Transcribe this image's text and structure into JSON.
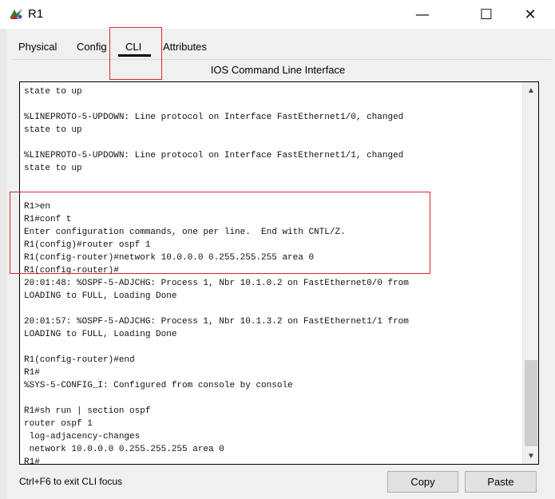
{
  "window": {
    "title": "R1",
    "minimize_glyph": "—",
    "maximize_glyph": "☐",
    "close_glyph": "✕"
  },
  "tabs": [
    {
      "label": "Physical"
    },
    {
      "label": "Config"
    },
    {
      "label": "CLI"
    },
    {
      "label": "Attributes"
    }
  ],
  "active_tab": "CLI",
  "section_title": "IOS Command Line Interface",
  "console": {
    "lines": [
      "state to up",
      "",
      "%LINEPROTO-5-UPDOWN: Line protocol on Interface FastEthernet1/0, changed",
      "state to up",
      "",
      "%LINEPROTO-5-UPDOWN: Line protocol on Interface FastEthernet1/1, changed",
      "state to up",
      "",
      "",
      "R1>en",
      "R1#conf t",
      "Enter configuration commands, one per line.  End with CNTL/Z.",
      "R1(config)#router ospf 1",
      "R1(config-router)#network 10.0.0.0 0.255.255.255 area 0",
      "R1(config-router)#",
      "20:01:48: %OSPF-5-ADJCHG: Process 1, Nbr 10.1.0.2 on FastEthernet0/0 from",
      "LOADING to FULL, Loading Done",
      "",
      "20:01:57: %OSPF-5-ADJCHG: Process 1, Nbr 10.1.3.2 on FastEthernet1/1 from",
      "LOADING to FULL, Loading Done",
      "",
      "R1(config-router)#end",
      "R1#",
      "%SYS-5-CONFIG_I: Configured from console by console",
      "",
      "R1#sh run | section ospf",
      "router ospf 1",
      " log-adjacency-changes",
      " network 10.0.0.0 0.255.255.255 area 0",
      "R1#"
    ]
  },
  "footer": {
    "hint": "Ctrl+F6 to exit CLI focus",
    "copy_label": "Copy",
    "paste_label": "Paste"
  },
  "colors": {
    "highlight": "#d8242b"
  }
}
